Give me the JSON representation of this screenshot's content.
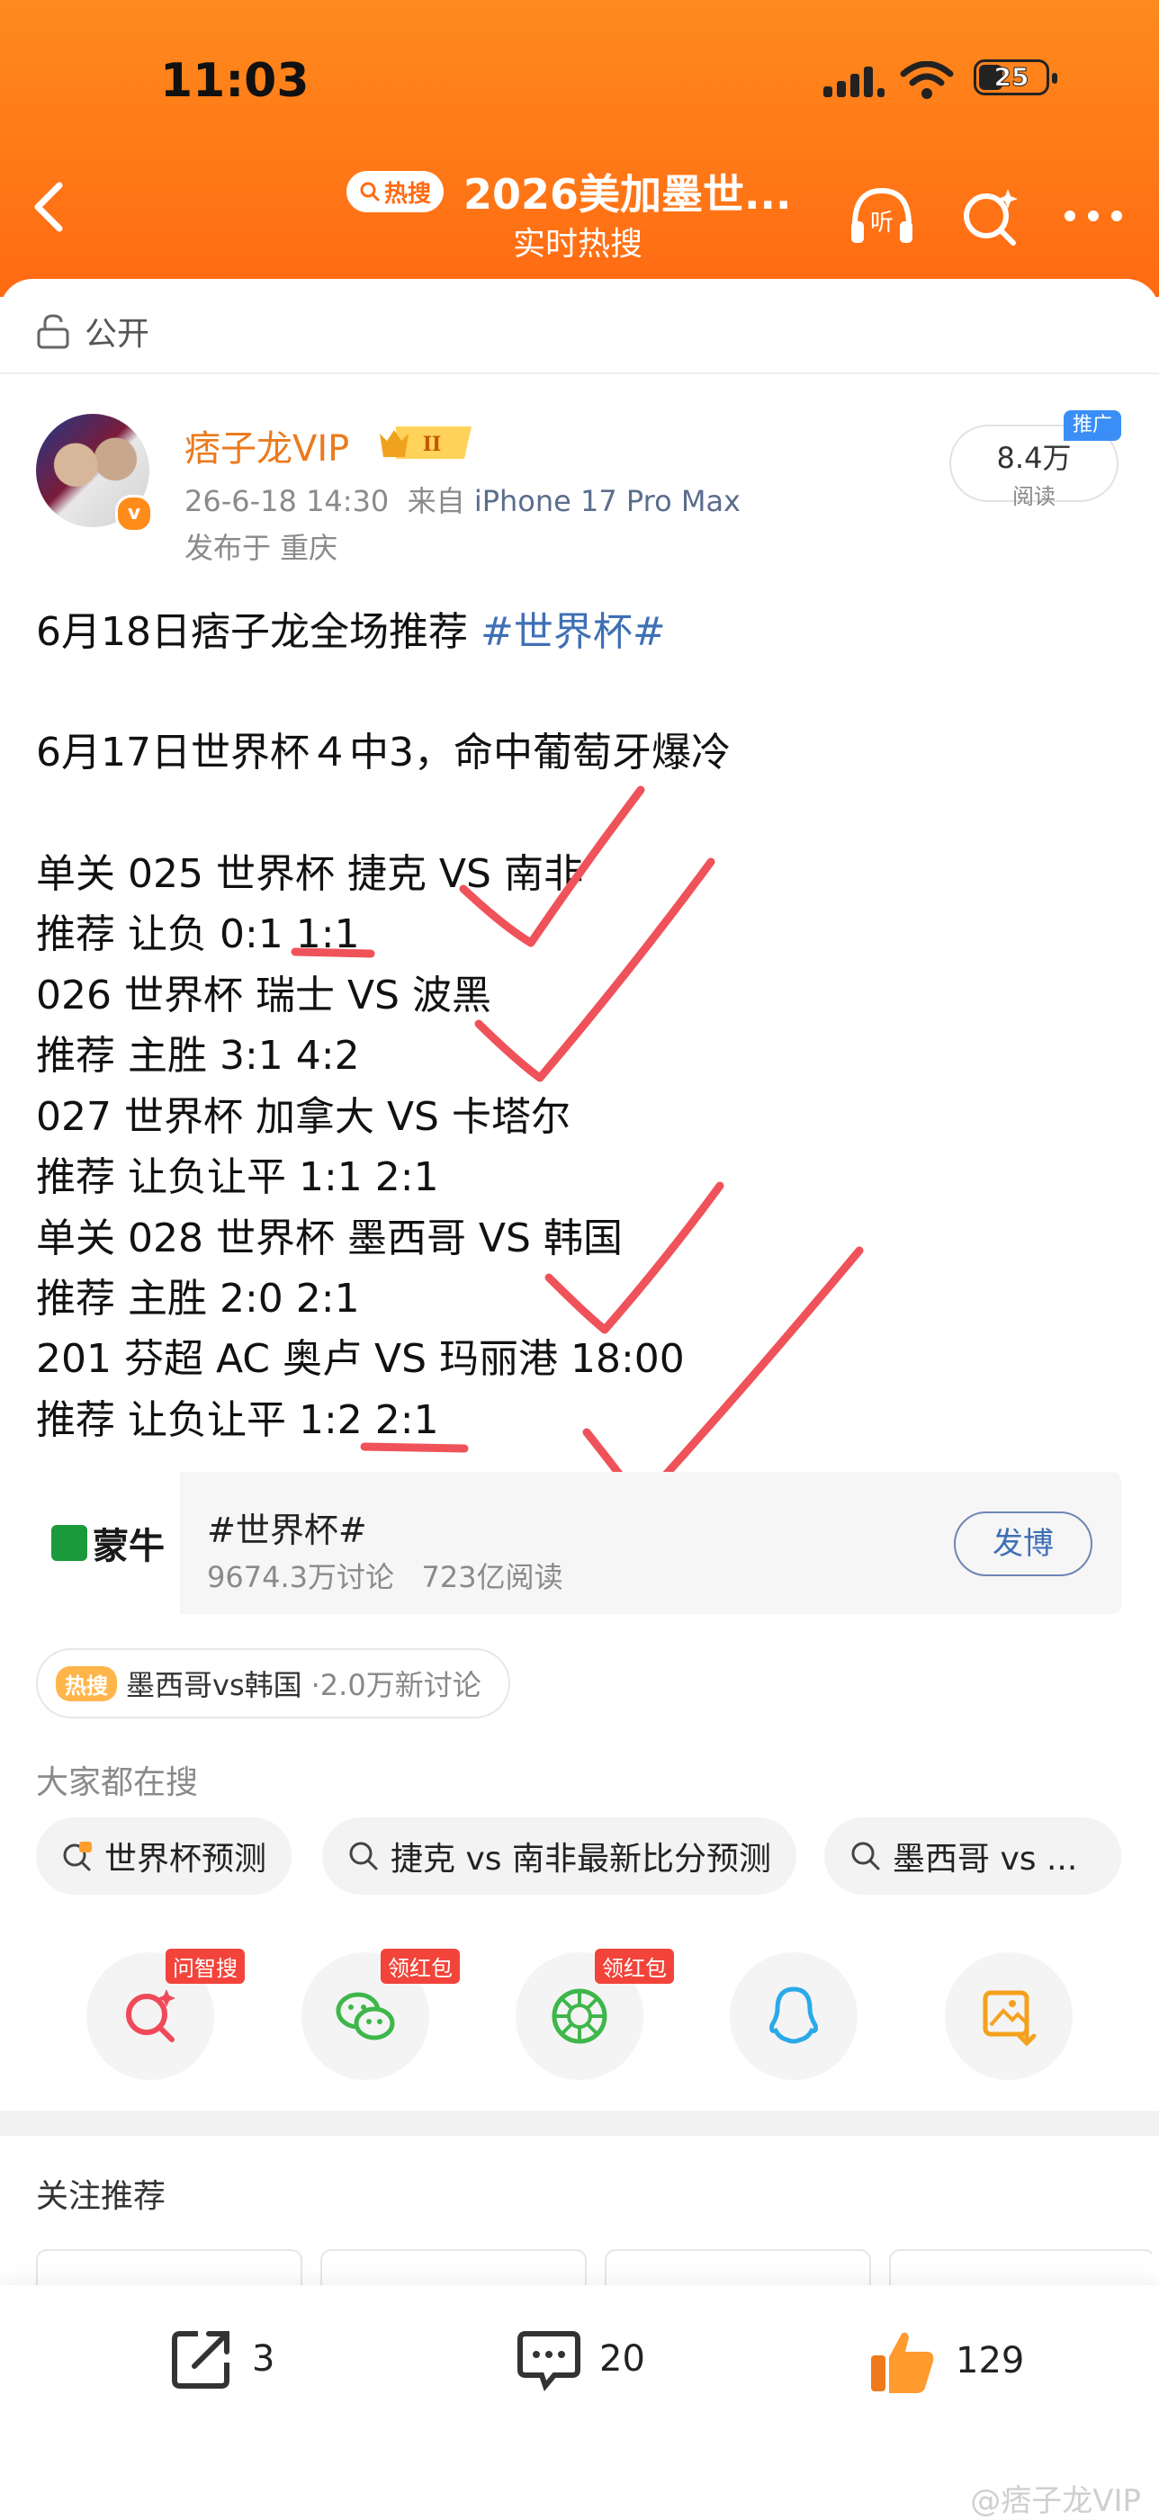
{
  "status_bar": {
    "time": "11:03",
    "battery": "25"
  },
  "nav": {
    "badge": "热搜",
    "title": "2026美加墨世...",
    "subtitle": "实时热搜",
    "listen_label": "听"
  },
  "visibility": "公开",
  "post": {
    "username": "痞子龙VIP",
    "vip_level": "II",
    "time": "26-6-18 14:30",
    "source_prefix": "来自",
    "device": "iPhone 17 Pro Max",
    "location": "发布于 重庆",
    "reads": "8.4万",
    "reads_label": "阅读",
    "promo": "推广",
    "line1_text": "6月18日痞子龙全场推荐 ",
    "line1_topic": "#世界杯#",
    "line2": "6月17日世界杯４中3，命中葡萄牙爆冷",
    "lines": [
      "单关 025 世界杯 捷克 VS 南非",
      "推荐 让负 0:1 1:1",
      "026 世界杯 瑞士 VS 波黑",
      "推荐 主胜 3:1 4:2",
      "027 世界杯 加拿大 VS 卡塔尔",
      "推荐 让负让平 1:1 2:1",
      "单关 028 世界杯 墨西哥 VS 韩国",
      "推荐 主胜 2:0 2:1",
      "201 芬超 AC 奥卢 VS 玛丽港 18:00",
      "推荐 让负让平 1:2 2:1"
    ]
  },
  "topic_card": {
    "brand": "蒙牛",
    "title": "#世界杯#",
    "discussions": "9674.3万讨论",
    "reads": "723亿阅读",
    "button": "发博"
  },
  "hot_chip": {
    "tag": "热搜",
    "text": "墨西哥vs韩国",
    "sub": "·2.0万新讨论"
  },
  "everyone_searching": {
    "label": "大家都在搜",
    "items": [
      "世界杯预测",
      "捷克 vs 南非最新比分预测",
      "墨西哥 vs ..."
    ]
  },
  "share_targets": [
    {
      "name": "wenzhi",
      "badge": "问智搜"
    },
    {
      "name": "wechat",
      "badge": "领红包"
    },
    {
      "name": "moments",
      "badge": "领红包"
    },
    {
      "name": "qq",
      "badge": ""
    },
    {
      "name": "save-image",
      "badge": ""
    }
  ],
  "follow_recommend": "关注推荐",
  "bottom_bar": {
    "shares": "3",
    "comments": "20",
    "likes": "129"
  },
  "watermark": "@痞子龙VIP",
  "colors": {
    "accent": "#ff6a12",
    "username": "#eb7a1d",
    "topic": "#3f6fb5",
    "check": "#f0525a"
  }
}
